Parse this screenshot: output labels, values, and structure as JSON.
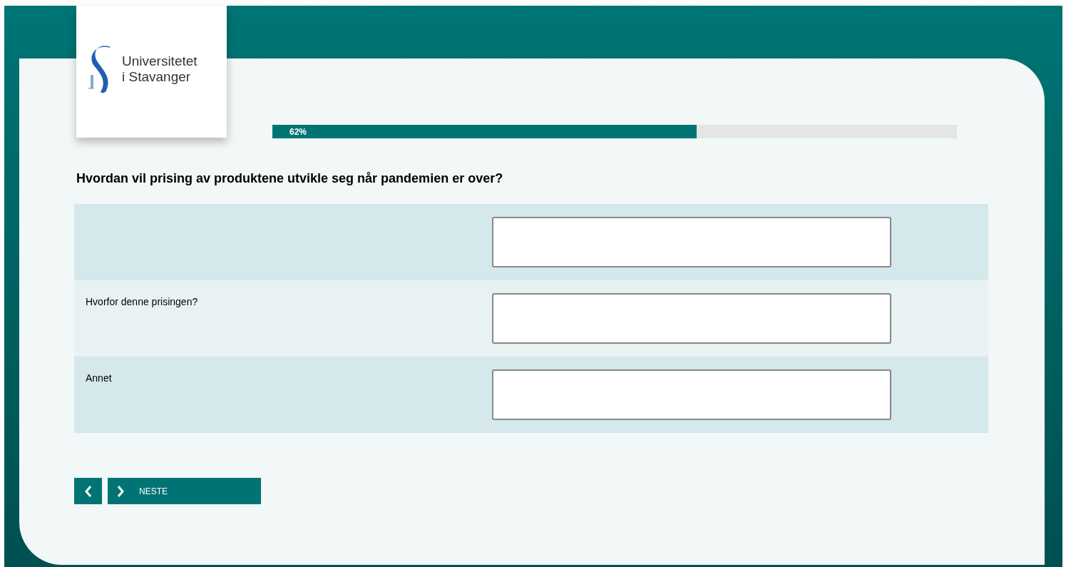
{
  "logo": {
    "lines": [
      "Universitetet",
      "i Stavanger"
    ]
  },
  "progress": {
    "label": "62%",
    "level": 0.62
  },
  "question": "Hvordan vil prising av produktene utvikle seg når pandemien er over?",
  "rows": [
    {},
    {
      "label": "Hvorfor denne prisingen?"
    },
    {
      "label": "Annet"
    }
  ],
  "next_button": {
    "label": "NESTE"
  }
}
